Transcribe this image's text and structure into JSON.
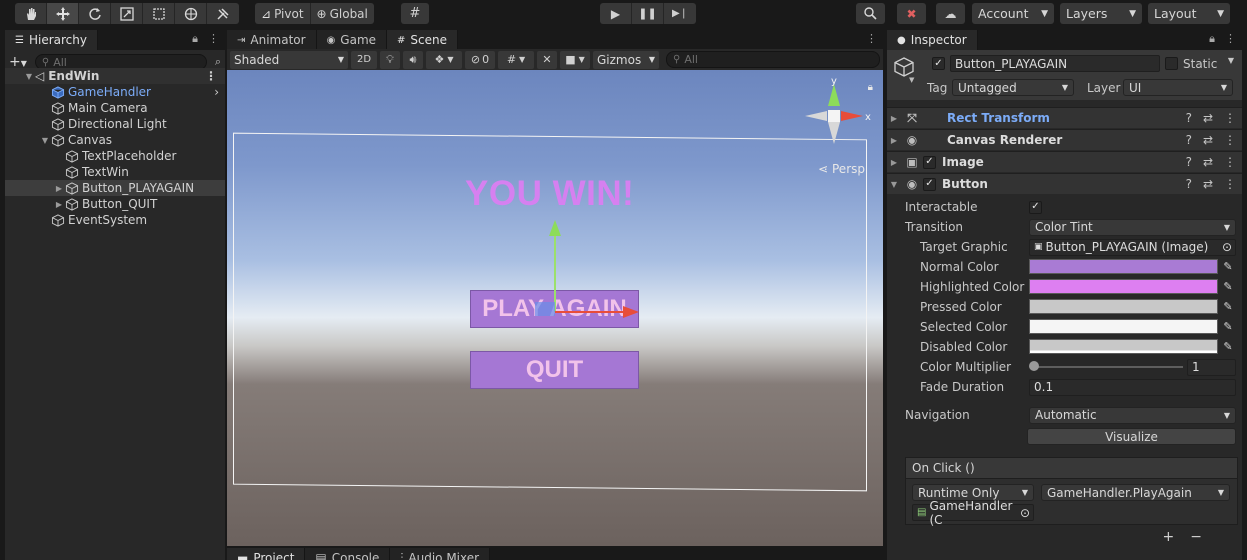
{
  "toolbar": {
    "pivot_label": "Pivot",
    "global_label": "Global",
    "account_label": "Account",
    "layers_label": "Layers",
    "layout_label": "Layout"
  },
  "hierarchy": {
    "tab_label": "Hierarchy",
    "search_placeholder": "All",
    "scene_name": "EndWin",
    "items": [
      {
        "label": "GameHandler"
      },
      {
        "label": "Main Camera"
      },
      {
        "label": "Directional Light"
      },
      {
        "label": "Canvas"
      },
      {
        "label": "TextPlaceholder"
      },
      {
        "label": "TextWin"
      },
      {
        "label": "Button_PLAYAGAIN"
      },
      {
        "label": "Button_QUIT"
      },
      {
        "label": "EventSystem"
      }
    ]
  },
  "scene": {
    "tabs": [
      {
        "label": "Animator"
      },
      {
        "label": "Game"
      },
      {
        "label": "Scene"
      }
    ],
    "shading_mode": "Shaded",
    "mode_2d": "2D",
    "hidden_count": "0",
    "gizmos_label": "Gizmos",
    "search_placeholder": "All",
    "persp_label": "Persp",
    "axis_y": "y",
    "axis_x": "x",
    "win_text": "YOU WIN!",
    "play_again_text": "PLAY AGAIN",
    "quit_text": "QUIT",
    "bottom_tabs": [
      {
        "label": "Project"
      },
      {
        "label": "Console"
      },
      {
        "label": "Audio Mixer"
      }
    ]
  },
  "inspector": {
    "tab_label": "Inspector",
    "object_name": "Button_PLAYAGAIN",
    "static_label": "Static",
    "tag_label": "Tag",
    "tag_value": "Untagged",
    "layer_label": "Layer",
    "layer_value": "UI",
    "components": [
      {
        "label": "Rect Transform"
      },
      {
        "label": "Canvas Renderer"
      },
      {
        "label": "Image"
      },
      {
        "label": "Button"
      }
    ],
    "button": {
      "interactable_label": "Interactable",
      "transition_label": "Transition",
      "transition_value": "Color Tint",
      "target_graphic_label": "Target Graphic",
      "target_graphic_value": "Button_PLAYAGAIN (Image)",
      "normal_color_label": "Normal Color",
      "normal_color": "#a97bd4",
      "highlighted_color_label": "Highlighted Color",
      "highlighted_color": "#dd7ff1",
      "pressed_color_label": "Pressed Color",
      "pressed_color": "#c8c8c8",
      "selected_color_label": "Selected Color",
      "selected_color": "#f5f5f5",
      "disabled_color_label": "Disabled Color",
      "disabled_color": "#c8c8c8",
      "color_multiplier_label": "Color Multiplier",
      "color_multiplier_value": "1",
      "fade_duration_label": "Fade Duration",
      "fade_duration_value": "0.1",
      "navigation_label": "Navigation",
      "navigation_value": "Automatic",
      "visualize_label": "Visualize",
      "onclick_label": "On Click ()",
      "runtime_value": "Runtime Only",
      "function_value": "GameHandler.PlayAgain",
      "object_value": "GameHandler (C"
    }
  },
  "colors": {
    "accent_blue": "#7cacf8",
    "button_purple": "#a577d4",
    "win_text": "#d680f0"
  }
}
